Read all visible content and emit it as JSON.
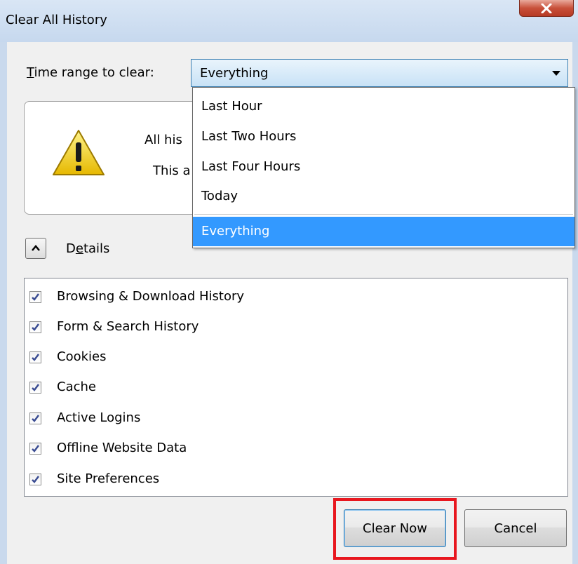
{
  "window": {
    "title": "Clear All History",
    "close_glyph": "X"
  },
  "time_range": {
    "label_access_key": "T",
    "label_rest": "ime range to clear:",
    "selected": "Everything",
    "options": [
      "Last Hour",
      "Last Two Hours",
      "Last Four Hours",
      "Today",
      "Everything"
    ]
  },
  "warning": {
    "icon": "warning-triangle-icon",
    "line1_partial": "All his",
    "line2_partial": "This a"
  },
  "details": {
    "label_first": "D",
    "label_access_key": "e",
    "label_rest": "tails"
  },
  "items": [
    {
      "label": "Browsing & Download History",
      "checked": true
    },
    {
      "label": "Form & Search History",
      "checked": true
    },
    {
      "label": "Cookies",
      "checked": true
    },
    {
      "label": "Cache",
      "checked": true
    },
    {
      "label": "Active Logins",
      "checked": true
    },
    {
      "label": "Offline Website Data",
      "checked": true
    },
    {
      "label": "Site Preferences",
      "checked": true
    }
  ],
  "buttons": {
    "clear_now": "Clear Now",
    "cancel": "Cancel"
  },
  "colors": {
    "selection": "#3399ff",
    "highlight_box": "#e8171f",
    "close_button": "#c8503a"
  }
}
